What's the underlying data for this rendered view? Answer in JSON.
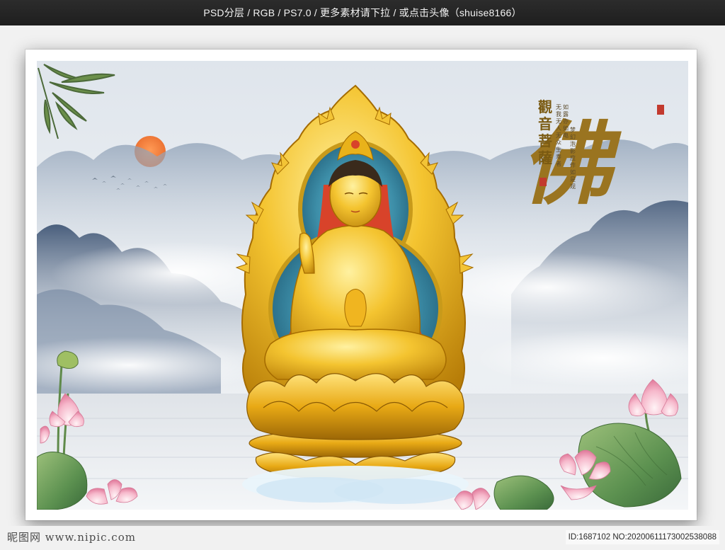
{
  "header": {
    "banner_text": "PSD分层 / RGB / PS7.0 / 更多素材请下拉 / 或点击头像（shuise8166）"
  },
  "artwork": {
    "title_vertical": "觀音菩薩",
    "big_character": "佛",
    "poem_columns": [
      "如露亦如电",
      "无我无人无众生寿者",
      "梦幻泡影应作如是观"
    ],
    "colors": {
      "sky": "#e6ebf0",
      "mountain": "#5d7390",
      "sun": "#ef7b3a",
      "gold": "#e9b21a",
      "lotus_pink": "#f2a9c1",
      "leaf_green": "#5c9150"
    }
  },
  "footer": {
    "logo_text": "昵图网 www.nipic.com",
    "image_id": "ID:1687102 NO:20200611173002538088"
  }
}
